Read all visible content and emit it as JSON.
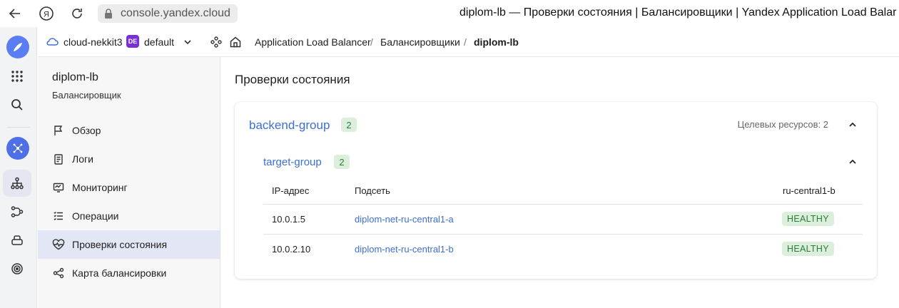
{
  "browser": {
    "url": "console.yandex.cloud",
    "title": "diplom-lb — Проверки состояния | Балансировщики | Yandex Application Load Balar"
  },
  "topbar": {
    "cloud": "cloud-nekkit3",
    "folder_badge": "DE",
    "folder": "default",
    "breadcrumbs": [
      "Application Load Balancer",
      "Балансировщики",
      "diplom-lb"
    ],
    "separator": "/"
  },
  "subnav": {
    "title": "diplom-lb",
    "subtitle": "Балансировщик",
    "items": [
      {
        "label": "Обзор",
        "icon": "flag-icon"
      },
      {
        "label": "Логи",
        "icon": "logs-icon"
      },
      {
        "label": "Мониторинг",
        "icon": "monitoring-icon"
      },
      {
        "label": "Операции",
        "icon": "operations-icon"
      },
      {
        "label": "Проверки состояния",
        "icon": "heartbeat-icon",
        "active": true
      },
      {
        "label": "Карта балансировки",
        "icon": "map-icon"
      }
    ]
  },
  "main": {
    "title": "Проверки состояния",
    "backend_group": {
      "name": "backend-group",
      "count": "2",
      "targets_label": "Целевых ресурсов: 2"
    },
    "target_group": {
      "name": "target-group",
      "count": "2"
    },
    "table": {
      "columns": [
        "IP-адрес",
        "Подсеть",
        "ru-central1-b"
      ],
      "rows": [
        {
          "ip": "10.0.1.5",
          "subnet": "diplom-net-ru-central1-a",
          "status": "HEALTHY"
        },
        {
          "ip": "10.0.2.10",
          "subnet": "diplom-net-ru-central1-b",
          "status": "HEALTHY"
        }
      ]
    }
  },
  "colors": {
    "link": "#3d6fd6",
    "healthy_bg": "#dcefdc",
    "healthy_text": "#2d7d3a",
    "folder_badge": "#7a2ed6"
  }
}
